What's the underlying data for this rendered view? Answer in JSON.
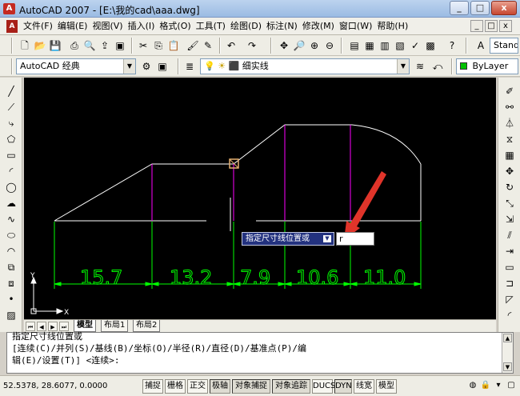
{
  "window": {
    "title": "AutoCAD 2007 - [E:\\我的cad\\aaa.dwg]",
    "app_icon": "A",
    "minimize_label": "_",
    "maximize_label": "□",
    "close_label": "x"
  },
  "menubar": {
    "doc_icon": "A",
    "items": [
      "文件(F)",
      "编辑(E)",
      "视图(V)",
      "插入(I)",
      "格式(O)",
      "工具(T)",
      "绘图(D)",
      "标注(N)",
      "修改(M)",
      "窗口(W)",
      "帮助(H)"
    ],
    "doc_controls": [
      "_",
      "□",
      "x"
    ]
  },
  "toolbar1": {
    "text_style_combo": "Stand"
  },
  "toolbar2": {
    "workspace_combo": "AutoCAD 经典",
    "layer_combo": "细实线",
    "color_combo": "ByLayer"
  },
  "drawing": {
    "dimensions": [
      "15.7",
      "13.2",
      "7.9",
      "10.6",
      "11.0"
    ],
    "ucs": {
      "x_label": "X",
      "y_label": "Y"
    },
    "colors": {
      "background": "#000000",
      "geometry": "#ffffff",
      "dimension": "#00ff00",
      "magenta": "#ff00ff",
      "annotation_arrow": "#e0342a",
      "osnap": "#e6b070"
    }
  },
  "dynamic_input": {
    "prompt": "指定尺寸线位置或",
    "value": "r"
  },
  "layout_tabs": [
    "模型",
    "布局1",
    "布局2"
  ],
  "command": {
    "lines": [
      "指定尺寸线位置或",
      "[连续(C)/并列(S)/基线(B)/坐标(O)/半径(R)/直径(D)/基准点(P)/编",
      "辑(E)/设置(T)] <连续>:"
    ]
  },
  "status": {
    "coordinates": "52.5378, 28.6077, 0.0000",
    "buttons": [
      "捕捉",
      "栅格",
      "正交",
      "极轴",
      "对象捕捉",
      "对象追踪",
      "DUCS",
      "DYN",
      "线宽",
      "模型"
    ]
  }
}
